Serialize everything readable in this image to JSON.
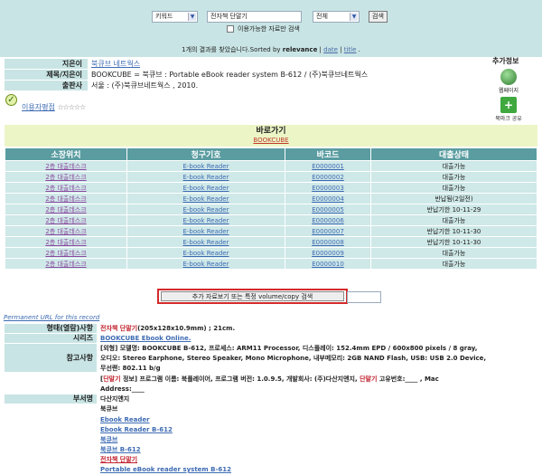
{
  "search": {
    "type_select": "키워드",
    "query": "전자책 단말기",
    "scope_select": "전체",
    "button": "검색",
    "limit_checkbox": "이용가능한 자료만 검색",
    "results_text": "1개의 결과를 찾았습니다.",
    "sorted_by_prefix": "Sorted by",
    "sort_relevance": "relevance",
    "sort_date": "date",
    "sort_title": "title"
  },
  "bib": {
    "author_label": "지은이",
    "author": "북큐브 네트웍스",
    "title_label": "제목/지은이",
    "title": "BOOKCUBE = 북큐브 : Portable eBook reader system B-612 / (주)북큐브네트웍스",
    "publisher_label": "출판사",
    "publisher": "서울 : (주)북큐브네트웍스 , 2010."
  },
  "side": {
    "heading": "추가정보",
    "webpage": "웹페이지",
    "bookmark": "북마크 공유"
  },
  "rating": {
    "label": "이용자평점",
    "stars": "☆☆☆☆☆"
  },
  "shortcut": {
    "title": "바로가기",
    "link": "BOOKCUBE"
  },
  "holdings": {
    "headers": [
      "소장위치",
      "청구기호",
      "바코드",
      "대출상태"
    ],
    "rows": [
      [
        "2층 대출데스크",
        "E-book Reader",
        "E0000001",
        "대출가능"
      ],
      [
        "2층 대출데스크",
        "E-book Reader",
        "E0000002",
        "대출가능"
      ],
      [
        "2층 대출데스크",
        "E-book Reader",
        "E0000003",
        "대출가능"
      ],
      [
        "2층 대출데스크",
        "E-book Reader",
        "E0000004",
        "반납됨(2일전)"
      ],
      [
        "2층 대출데스크",
        "E-book Reader",
        "E0000005",
        "반납기한 10-11-29"
      ],
      [
        "2층 대출데스크",
        "E-book Reader",
        "E0000006",
        "대출가능"
      ],
      [
        "2층 대출데스크",
        "E-book Reader",
        "E0000007",
        "반납기한 10-11-30"
      ],
      [
        "2층 대출데스크",
        "E-book Reader",
        "E0000008",
        "반납기한 10-11-30"
      ],
      [
        "2층 대출데스크",
        "E-book Reader",
        "E0000009",
        "대출가능"
      ],
      [
        "2층 대출데스크",
        "E-book Reader",
        "E0000010",
        "대출가능"
      ]
    ]
  },
  "more_button": "추가 자료보기 또는 특정 volume/copy 검색",
  "permanent_url": "Permanent URL for this record",
  "details": {
    "physical_label": "형태(열람)사항",
    "physical_red": "전자책 단말기",
    "physical_rest": "(205x128x10.9mm) ; 21cm.",
    "series_label": "시리즈",
    "series": "BOOKCUBE Ebook Online.",
    "notes_label": "참고사항",
    "note1_a": "[외형] 모델명: BOOKCUBE B-612, 프로세스: ARM11 Processor, 디스플레이: 152.4mm EPD / 600x800 pixels / 8 gray,",
    "note1_b": "오디오: Stereo Earphone, Stereo Speaker, Mono Microphone, 내부메모리: 2GB NAND Flash, USB: USB 2.0 Device,",
    "note1_c": "무선랜: 802.11 b/g",
    "note2_a_pre": "[",
    "note2_a_red1": "단말기",
    "note2_a_mid": " 정보] 프로그램 이름: 북플레이어, 프로그램 버전: 1.0.9.5, 개발회사: (주)다산지앤지, ",
    "note2_a_red2": "단말기",
    "note2_a_post": " 고유번호:____ , Mac",
    "note2_b": "Address:____",
    "subjects_label": "부서명",
    "subjects": [
      "다산지앤지",
      "북큐브",
      "Ebook Reader",
      "Ebook Reader B-612",
      "북큐브",
      "북큐브 B-612",
      "전자책 단말기",
      "Portable eBook reader system B-612"
    ]
  }
}
